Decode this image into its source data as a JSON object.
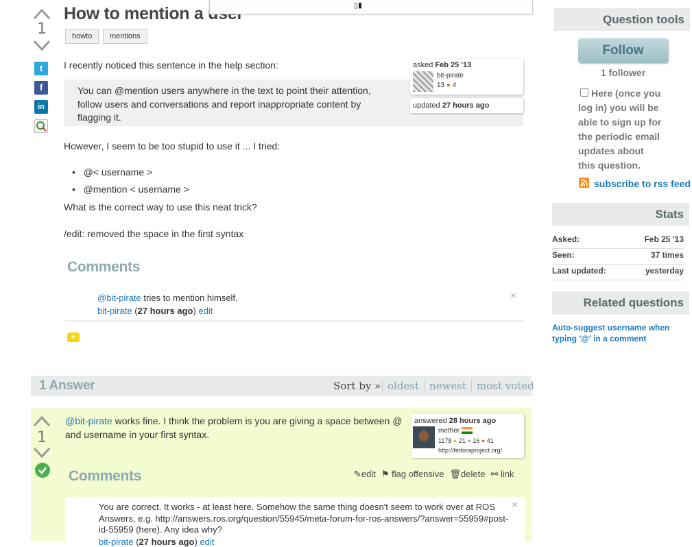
{
  "top_popup": {
    "glyph": "▯▮"
  },
  "question": {
    "votes": "1",
    "title": "How to mention a user",
    "tags": [
      "howto",
      "mentions"
    ],
    "body": {
      "p1": "I recently noticed this sentence in the help section:",
      "quote": "You can @mention users anywhere in the text to point their attention, follow users and conversations and report inappropriate content by flagging it.",
      "p2": "However, I seem to be too stupid to use it ... I tried:",
      "list": [
        "@< username >",
        "@mention < username >"
      ],
      "p3": "What is the correct way to use this neat trick?",
      "p4": "/edit: removed the space in the first syntax"
    },
    "asked": {
      "label": "asked",
      "date": "Feb 25 '13",
      "user": "bit-pirate",
      "rep": "13",
      "badge_count": "4"
    },
    "updated": {
      "label": "updated",
      "when": "27 hours ago"
    },
    "share": {
      "twitter": "t",
      "facebook": "f",
      "linkedin": "in"
    },
    "comments_title": "Comments",
    "comment": {
      "mention": "@bit-pirate",
      "text": " tries to mention himself.",
      "author": "bit-pirate",
      "time": "27 hours ago",
      "edit": "edit",
      "close": "×"
    }
  },
  "answers_header": {
    "count": "1 Answer",
    "sort_by": "Sort by »",
    "options": [
      "oldest",
      "newest",
      "most voted"
    ]
  },
  "answer": {
    "votes": "1",
    "mention": "@bit-pirate",
    "text": " works fine. I think the problem is you are giving a space between @ and username in your first syntax.",
    "answered": {
      "label": "answered",
      "when": "28 hours ago",
      "user": "mether",
      "rep": "1178",
      "gold": "21",
      "silver": "16",
      "bronze": "41",
      "site": "http://fedoraproject.org/"
    },
    "comments_title": "Comments",
    "controls": {
      "edit": "edit",
      "flag": "flag offensive",
      "delete": "delete",
      "link": "link"
    },
    "comment": {
      "text": "You are correct. It works - at least here. Somehow the same thing doesn't seem to work over at ROS Answers, e.g. http://answers.ros.org/question/55945/meta-forum-for-ros-answers/?answer=55959#post-id-55959 (here). Any idea why?",
      "author": "bit-pirate",
      "time": "27 hours ago",
      "edit": "edit",
      "close": "×"
    }
  },
  "sidebar": {
    "tools_title": "Question tools",
    "follow_button": "Follow",
    "followers": "1 follower",
    "email_note": "Here (once you log in) you will be able to sign up for the periodic email updates about this question.",
    "rss_link": "subscribe to rss feed",
    "stats_title": "Stats",
    "stats": [
      {
        "label": "Asked:",
        "value": "Feb 25 '13"
      },
      {
        "label": "Seen:",
        "value": "37 times"
      },
      {
        "label": "Last updated:",
        "value": "yesterday"
      }
    ],
    "related_title": "Related questions",
    "related": [
      "Auto-suggest username when typing '@' in a comment"
    ]
  },
  "colors": {
    "link": "#1b79bd",
    "answer_bg": "#f3fbd0",
    "section_title": "#8caab0",
    "accepted": "#4caf50",
    "follow_button": "#a9c6cc"
  }
}
